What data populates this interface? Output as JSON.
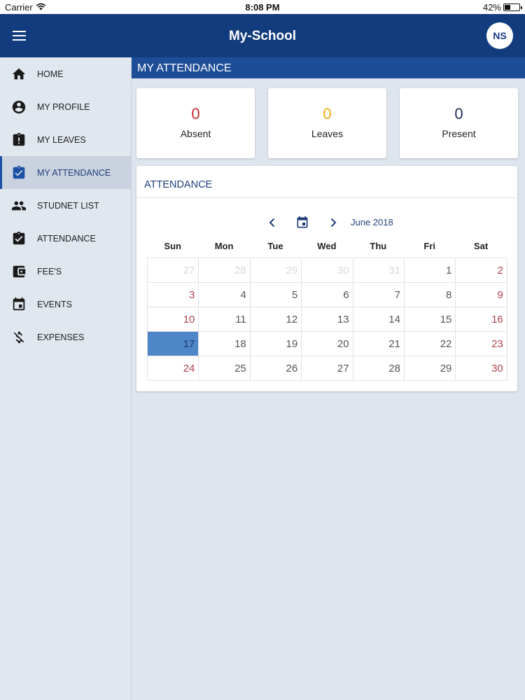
{
  "status_bar": {
    "carrier": "Carrier",
    "time": "8:08 PM",
    "battery": "42%",
    "battery_level": 0.42
  },
  "app_bar": {
    "title": "My-School",
    "avatar_initials": "NS"
  },
  "sidebar": {
    "items": [
      {
        "label": "HOME",
        "icon": "home-icon"
      },
      {
        "label": "MY PROFILE",
        "icon": "account-circle-icon"
      },
      {
        "label": "MY LEAVES",
        "icon": "clipboard-alert-icon"
      },
      {
        "label": "MY ATTENDANCE",
        "icon": "clipboard-check-icon",
        "active": true
      },
      {
        "label": "STUDNET LIST",
        "icon": "people-icon"
      },
      {
        "label": "ATTENDANCE",
        "icon": "clipboard-check-icon"
      },
      {
        "label": "FEE'S",
        "icon": "wallet-icon"
      },
      {
        "label": "EVENTS",
        "icon": "calendar-event-icon"
      },
      {
        "label": "EXPENSES",
        "icon": "dollar-off-icon"
      }
    ]
  },
  "page": {
    "section_title": "MY ATTENDANCE"
  },
  "stats": {
    "absent": {
      "value": "0",
      "label": "Absent"
    },
    "leaves": {
      "value": "0",
      "label": "Leaves"
    },
    "present": {
      "value": "0",
      "label": "Present"
    }
  },
  "calendar": {
    "title": "ATTENDANCE",
    "month_label": "June 2018",
    "weekdays": [
      "Sun",
      "Mon",
      "Tue",
      "Wed",
      "Thu",
      "Fri",
      "Sat"
    ],
    "weeks": [
      [
        "27",
        "28",
        "29",
        "30",
        "31",
        "1",
        "2"
      ],
      [
        "3",
        "4",
        "5",
        "6",
        "7",
        "8",
        "9"
      ],
      [
        "10",
        "11",
        "12",
        "13",
        "14",
        "15",
        "16"
      ],
      [
        "17",
        "18",
        "19",
        "20",
        "21",
        "22",
        "23"
      ],
      [
        "24",
        "25",
        "26",
        "27",
        "28",
        "29",
        "30"
      ]
    ],
    "leading_other_month_days": 5,
    "selected_day": "17",
    "colors": {
      "weekend": "#b0434f",
      "selected": "#4e86c8",
      "header": "#1e4d97",
      "app_bar": "#133c7e"
    }
  }
}
